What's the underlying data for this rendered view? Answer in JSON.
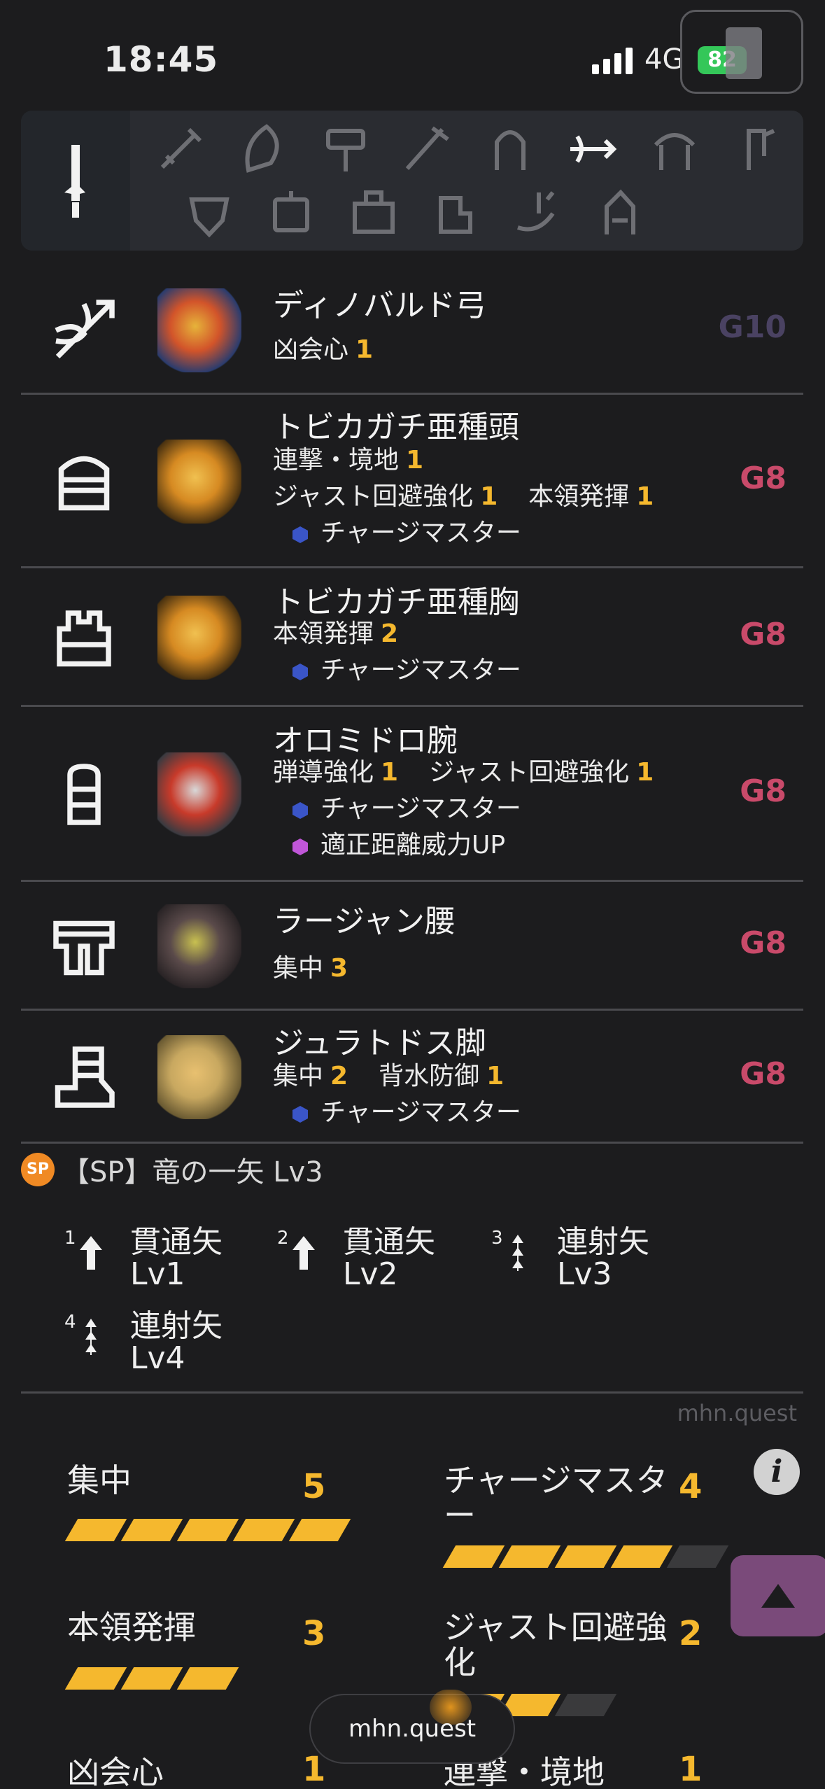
{
  "status": {
    "time": "18:45",
    "network": "4G",
    "battery": "82"
  },
  "weapon_icons": [
    "great-sword",
    "sword-and-shield",
    "dual-blades",
    "hammer",
    "long-sword",
    "hunting-horn",
    "bow",
    "lance",
    "gunlance",
    "switch-axe",
    "charge-blade",
    "insect-glaive",
    "heavy-bowgun",
    "light-bowgun",
    "palico-weapon"
  ],
  "armor": [
    {
      "slot": "weapon",
      "name": "ディノバルド弓",
      "skills": [
        {
          "name": "凶会心",
          "level": "1"
        }
      ],
      "decorations": [],
      "grade": "G10",
      "grade_color": "#4a4262",
      "thumb_colors": [
        "#2a3c6e",
        "#d2542a",
        "#e6b33a"
      ]
    },
    {
      "slot": "head",
      "name": "トビカガチ亜種頭",
      "skills": [
        {
          "name": "連撃・境地",
          "level": "1"
        },
        {
          "name": "ジャスト回避強化",
          "level": "1"
        },
        {
          "name": "本領発揮",
          "level": "1"
        }
      ],
      "decorations": [
        {
          "name": "チャージマスター",
          "color": "#3a55c8"
        }
      ],
      "grade": "G8",
      "grade_color": "#c94a6a",
      "thumb_colors": [
        "#4a3210",
        "#d68a22",
        "#f0c050"
      ]
    },
    {
      "slot": "chest",
      "name": "トビカガチ亜種胸",
      "skills": [
        {
          "name": "本領発揮",
          "level": "2"
        }
      ],
      "decorations": [
        {
          "name": "チャージマスター",
          "color": "#3a55c8"
        }
      ],
      "grade": "G8",
      "grade_color": "#c94a6a",
      "thumb_colors": [
        "#4a3210",
        "#d68a22",
        "#f0c050"
      ]
    },
    {
      "slot": "arms",
      "name": "オロミドロ腕",
      "skills": [
        {
          "name": "弾導強化",
          "level": "1"
        },
        {
          "name": "ジャスト回避強化",
          "level": "1"
        }
      ],
      "decorations": [
        {
          "name": "チャージマスター",
          "color": "#3a55c8"
        },
        {
          "name": "適正距離威力UP",
          "color": "#c056d8"
        }
      ],
      "grade": "G8",
      "grade_color": "#c94a6a",
      "thumb_colors": [
        "#3a3a40",
        "#c83a2a",
        "#d8d8d8"
      ]
    },
    {
      "slot": "waist",
      "name": "ラージャン腰",
      "skills": [
        {
          "name": "集中",
          "level": "3"
        }
      ],
      "decorations": [],
      "grade": "G8",
      "grade_color": "#c94a6a",
      "thumb_colors": [
        "#2a2426",
        "#5a4a4a",
        "#c8c050"
      ]
    },
    {
      "slot": "legs",
      "name": "ジュラトドス脚",
      "skills": [
        {
          "name": "集中",
          "level": "2"
        },
        {
          "name": "背水防御",
          "level": "1"
        }
      ],
      "decorations": [
        {
          "name": "チャージマスター",
          "color": "#3a55c8"
        }
      ],
      "grade": "G8",
      "grade_color": "#c94a6a",
      "thumb_colors": [
        "#6a5a32",
        "#c8a860",
        "#e8c070"
      ]
    }
  ],
  "sp": {
    "badge": "SP",
    "label": "【SP】竜の一矢 Lv3"
  },
  "shots": [
    {
      "num": "1",
      "name": "貫通矢",
      "level": "Lv1",
      "type": "pierce"
    },
    {
      "num": "2",
      "name": "貫通矢",
      "level": "Lv2",
      "type": "pierce"
    },
    {
      "num": "3",
      "name": "連射矢",
      "level": "Lv3",
      "type": "rapid"
    },
    {
      "num": "4",
      "name": "連射矢",
      "level": "Lv4",
      "type": "rapid"
    }
  ],
  "watermark": "mhn.quest",
  "skill_summary": [
    {
      "name": "集中",
      "level": "5",
      "max": 5,
      "filled": 5
    },
    {
      "name": "チャージマスター",
      "level": "4",
      "max": 5,
      "filled": 4
    },
    {
      "name": "本領発揮",
      "level": "3",
      "max": 3,
      "filled": 3
    },
    {
      "name": "ジャスト回避強化",
      "level": "2",
      "max": 3,
      "filled": 2
    }
  ],
  "partial_skills": [
    {
      "name": "凶会心",
      "level": "1"
    },
    {
      "name": "連撃・境地",
      "level": "1"
    }
  ],
  "info_label": "i",
  "url_pill": "mhn.quest"
}
